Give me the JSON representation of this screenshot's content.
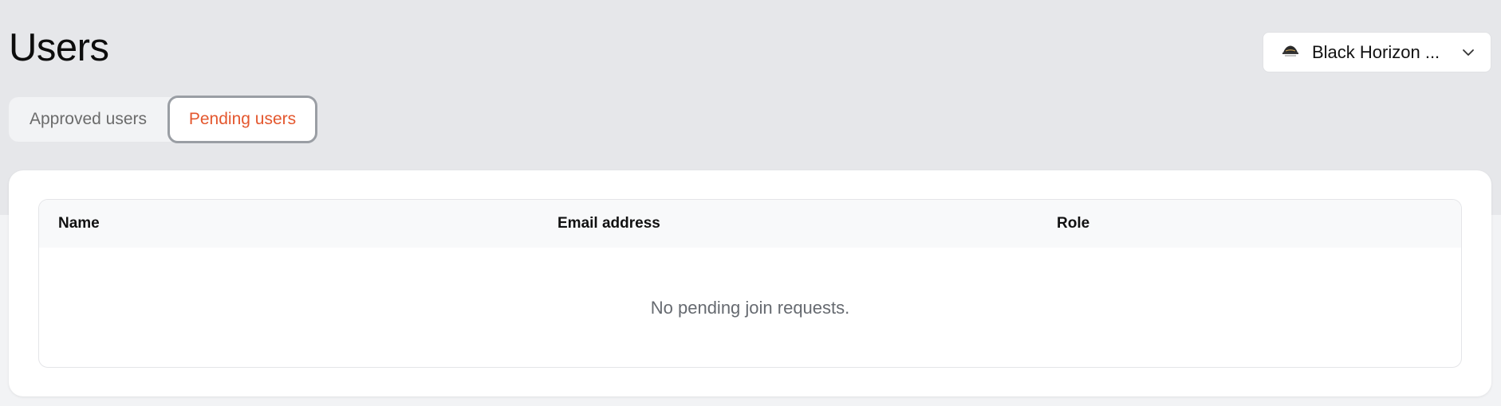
{
  "page": {
    "title": "Users"
  },
  "org_selector": {
    "name": "Black Horizon ...",
    "logo_icon": "org-logo-icon",
    "chevron_icon": "chevron-down-icon"
  },
  "tabs": [
    {
      "label": "Approved users",
      "active": false
    },
    {
      "label": "Pending users",
      "active": true
    }
  ],
  "table": {
    "columns": [
      "Name",
      "Email address",
      "Role"
    ],
    "empty_message": "No pending join requests."
  },
  "colors": {
    "accent": "#e4572e",
    "background": "#e6e7ea",
    "card": "#ffffff"
  }
}
